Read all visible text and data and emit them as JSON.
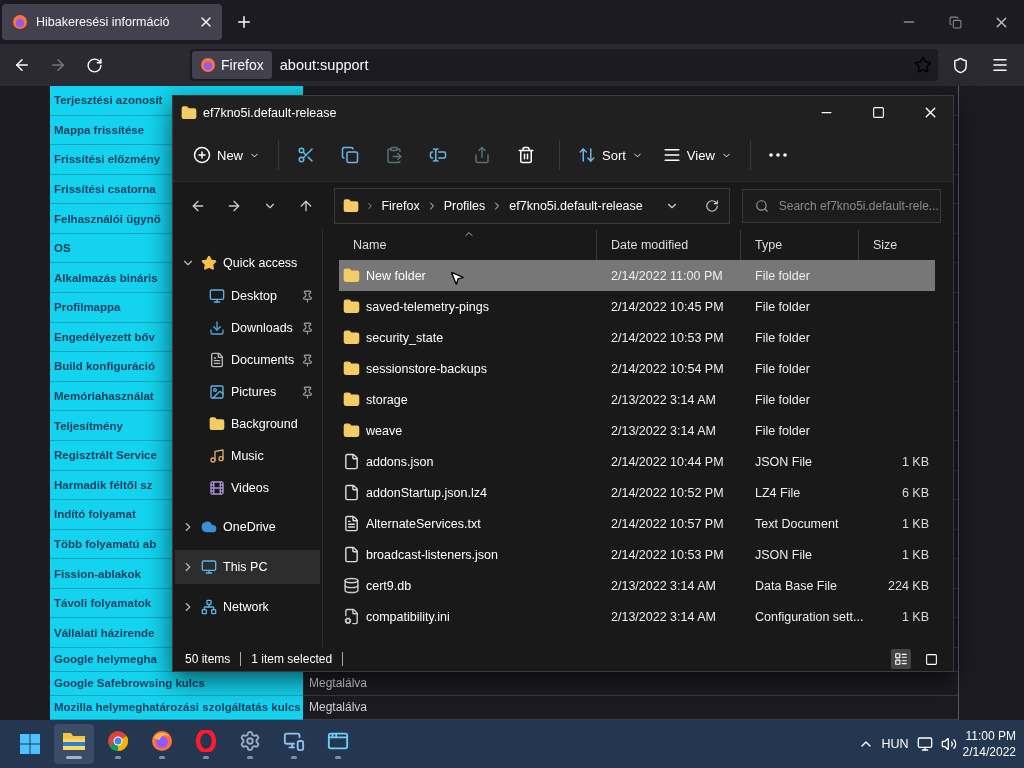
{
  "browser": {
    "tab": {
      "title": "Hibakeresési információ"
    },
    "identity": "Firefox",
    "url": "about:support"
  },
  "support_table": [
    {
      "label": "Terjesztési azonosít"
    },
    {
      "label": "Mappa frissítése"
    },
    {
      "label": "Frissítési előzmény"
    },
    {
      "label": "Frissítési csatorna"
    },
    {
      "label": "Felhasználói ügynö"
    },
    {
      "label": "OS"
    },
    {
      "label": "Alkalmazás bináris"
    },
    {
      "label": "Profilmappa"
    },
    {
      "label": "Engedélyezett bőv"
    },
    {
      "label": "Build konfiguráció"
    },
    {
      "label": "Memóriahasználat"
    },
    {
      "label": "Teljesítmény"
    },
    {
      "label": "Regisztrált Service"
    },
    {
      "label": "Harmadik féltől sz"
    },
    {
      "label": "Indító folyamat"
    },
    {
      "label": "Több folyamatú ab"
    },
    {
      "label": "Fission-ablakok"
    },
    {
      "label": "Távoli folyamatok"
    },
    {
      "label": "Vállalati házirende"
    },
    {
      "label": "Google helymegha"
    },
    {
      "label": "Google Safebrowsing kulcs",
      "value": "Megtalálva"
    },
    {
      "label": "Mozilla helymeghatározási szolgáltatás kulcs",
      "value": "Megtalálva"
    }
  ],
  "explorer": {
    "title": "ef7kno5i.default-release",
    "toolbar": [
      {
        "kind": "new",
        "label": "New",
        "disabled": false
      },
      {
        "kind": "cut",
        "disabled": false
      },
      {
        "kind": "copy",
        "disabled": false
      },
      {
        "kind": "paste",
        "disabled": true
      },
      {
        "kind": "rename",
        "disabled": false
      },
      {
        "kind": "share",
        "disabled": true
      },
      {
        "kind": "delete",
        "disabled": false
      },
      {
        "kind": "sort",
        "label": "Sort",
        "disabled": false
      },
      {
        "kind": "view",
        "label": "View",
        "disabled": false
      },
      {
        "kind": "more",
        "disabled": false
      }
    ],
    "breadcrumb": [
      "Firefox",
      "Profiles",
      "ef7kno5i.default-release"
    ],
    "search": {
      "placeholder": "Search ef7kno5i.default-rele..."
    },
    "nav": [
      {
        "kind": "quick",
        "label": "Quick access",
        "expanded": true,
        "selected": false,
        "children": [
          {
            "kind": "desktop",
            "label": "Desktop",
            "pinned": true,
            "selected": false
          },
          {
            "kind": "downloads",
            "label": "Downloads",
            "pinned": true,
            "selected": false
          },
          {
            "kind": "documents",
            "label": "Documents",
            "pinned": true,
            "selected": false
          },
          {
            "kind": "pictures",
            "label": "Pictures",
            "pinned": true,
            "selected": false
          },
          {
            "kind": "folder",
            "label": "Background",
            "pinned": false,
            "selected": false
          },
          {
            "kind": "music",
            "label": "Music",
            "pinned": false,
            "selected": false
          },
          {
            "kind": "videos",
            "label": "Videos",
            "pinned": false,
            "selected": false
          }
        ]
      },
      {
        "kind": "cloud",
        "label": "OneDrive",
        "expanded": false,
        "selected": false
      },
      {
        "kind": "pc",
        "label": "This PC",
        "expanded": false,
        "selected": true
      },
      {
        "kind": "network",
        "label": "Network",
        "expanded": false,
        "selected": false
      }
    ],
    "columns": [
      "Name",
      "Date modified",
      "Type",
      "Size"
    ],
    "files": [
      {
        "kind": "folder",
        "name": "New folder",
        "date": "2/14/2022 11:00 PM",
        "type": "File folder",
        "selected": true
      },
      {
        "kind": "folder",
        "name": "saved-telemetry-pings",
        "date": "2/14/2022 10:45 PM",
        "type": "File folder",
        "selected": false
      },
      {
        "kind": "folder",
        "name": "security_state",
        "date": "2/14/2022 10:53 PM",
        "type": "File folder",
        "selected": false
      },
      {
        "kind": "folder",
        "name": "sessionstore-backups",
        "date": "2/14/2022 10:54 PM",
        "type": "File folder",
        "selected": false
      },
      {
        "kind": "folder",
        "name": "storage",
        "date": "2/13/2022 3:14 AM",
        "type": "File folder",
        "selected": false
      },
      {
        "kind": "folder",
        "name": "weave",
        "date": "2/13/2022 3:14 AM",
        "type": "File folder",
        "selected": false
      },
      {
        "kind": "file",
        "name": "addons.json",
        "date": "2/14/2022 10:44 PM",
        "type": "JSON File",
        "size": "1 KB",
        "selected": false
      },
      {
        "kind": "file",
        "name": "addonStartup.json.lz4",
        "date": "2/14/2022 10:52 PM",
        "type": "LZ4 File",
        "size": "6 KB",
        "selected": false
      },
      {
        "kind": "text",
        "name": "AlternateServices.txt",
        "date": "2/14/2022 10:57 PM",
        "type": "Text Document",
        "size": "1 KB",
        "selected": false
      },
      {
        "kind": "file",
        "name": "broadcast-listeners.json",
        "date": "2/14/2022 10:53 PM",
        "type": "JSON File",
        "size": "1 KB",
        "selected": false
      },
      {
        "kind": "db",
        "name": "cert9.db",
        "date": "2/13/2022 3:14 AM",
        "type": "Data Base File",
        "size": "224 KB",
        "selected": false
      },
      {
        "kind": "config",
        "name": "compatibility.ini",
        "date": "2/13/2022 3:14 AM",
        "type": "Configuration sett...",
        "size": "1 KB",
        "selected": false
      }
    ],
    "status": {
      "count": "50 items",
      "selection": "1 item selected"
    },
    "views": [
      {
        "kind": "details",
        "selected": true
      },
      {
        "kind": "tiles",
        "selected": false
      }
    ]
  },
  "taskbar": {
    "apps": [
      {
        "kind": "start",
        "active": false,
        "running": false
      },
      {
        "kind": "explorer",
        "active": true,
        "running": true
      },
      {
        "kind": "chrome",
        "active": false,
        "running": true
      },
      {
        "kind": "firefox",
        "active": false,
        "running": true
      },
      {
        "kind": "opera",
        "active": false,
        "running": true
      },
      {
        "kind": "settings",
        "active": false,
        "running": true
      },
      {
        "kind": "remote",
        "active": false,
        "running": true
      },
      {
        "kind": "window",
        "active": false,
        "running": true
      }
    ],
    "language": "HUN",
    "time": "11:00 PM",
    "date": "2/14/2022"
  }
}
